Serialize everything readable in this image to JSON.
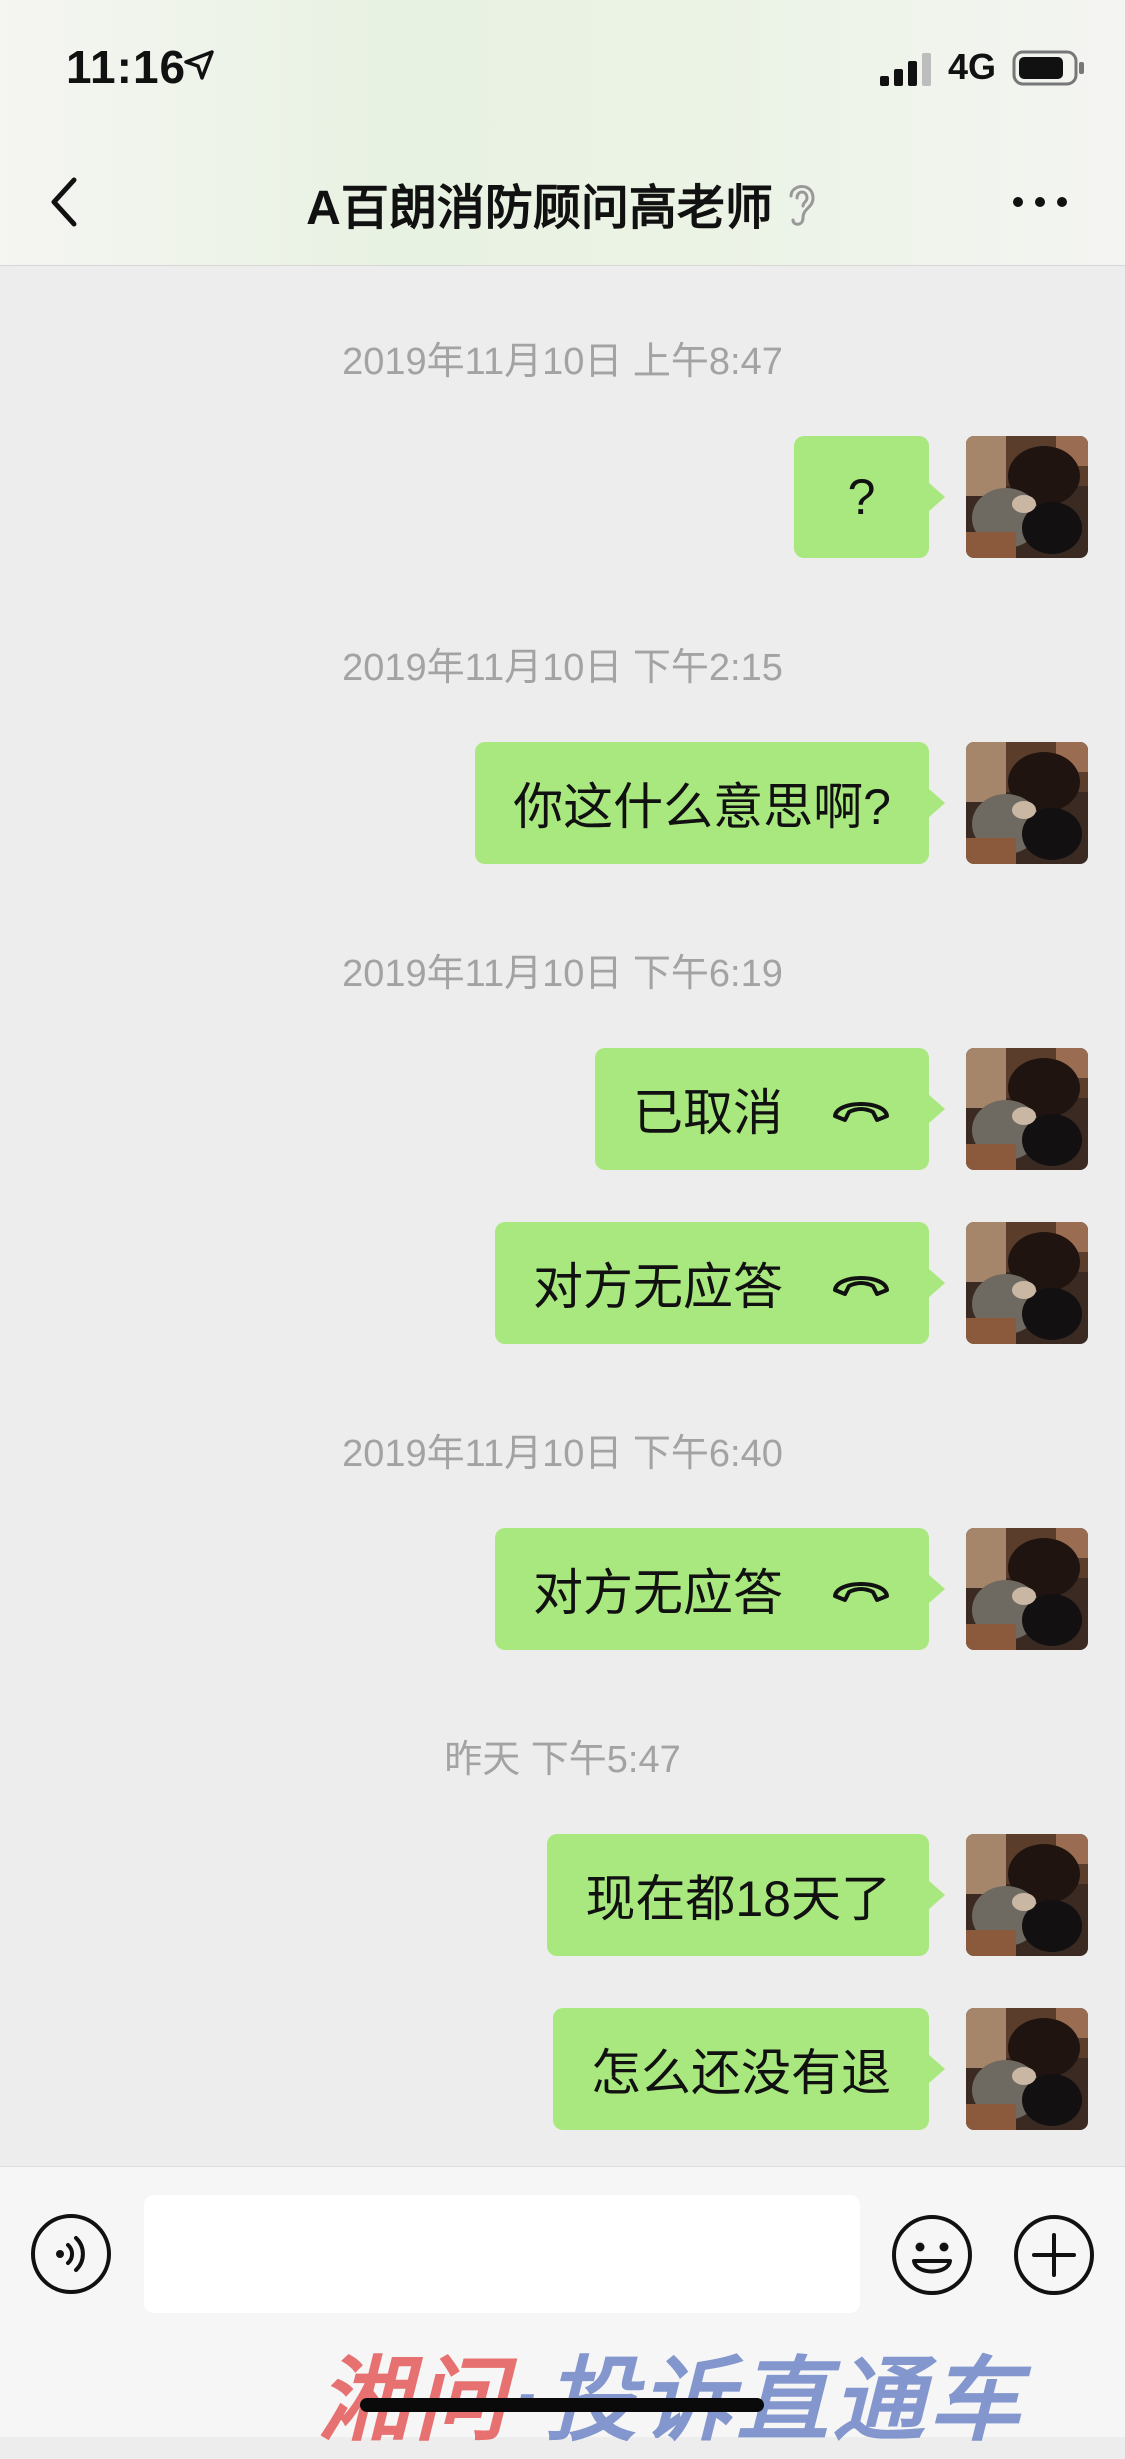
{
  "status_bar": {
    "time": "11:16",
    "network": "4G"
  },
  "nav": {
    "title": "A百朗消防顾问高老师"
  },
  "messages": {
    "ts1": "2019年11月10日 上午8:47",
    "m1": "?",
    "ts2": "2019年11月10日 下午2:15",
    "m2": "你这什么意思啊?",
    "ts3": "2019年11月10日 下午6:19",
    "m3": "已取消",
    "m4": "对方无应答",
    "ts4": "2019年11月10日 下午6:40",
    "m5": "对方无应答",
    "ts5": "昨天 下午5:47",
    "m6": "现在都18天了",
    "m7": "怎么还没有退"
  },
  "watermark": {
    "part1": "湘问",
    "part2": "·投诉直通车"
  },
  "colors": {
    "bubble": "#a9e87e",
    "background": "#ededed",
    "timestamp": "#a3a3a3"
  }
}
